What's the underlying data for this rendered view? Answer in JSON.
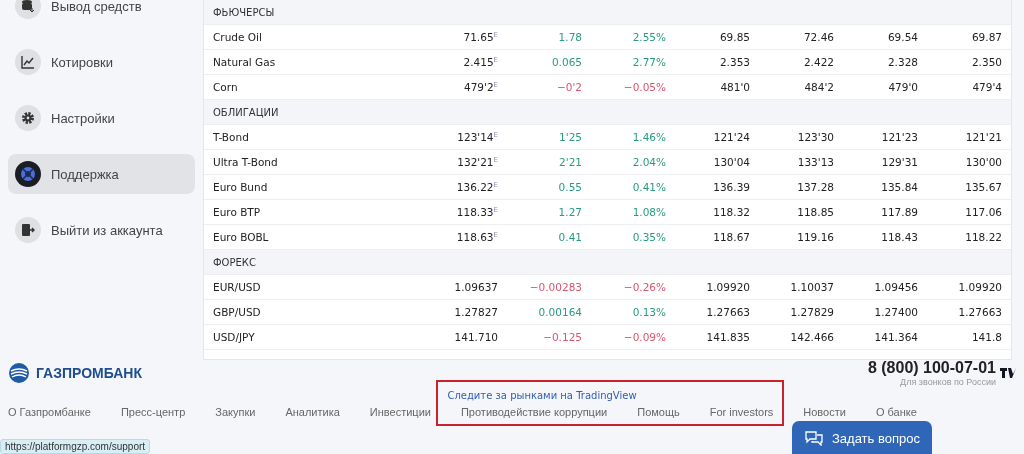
{
  "sidebar": {
    "items": [
      {
        "label": "Вывод средств",
        "kind": "withdraw",
        "selected": false
      },
      {
        "label": "Котировки",
        "kind": "chart",
        "selected": false
      },
      {
        "label": "Настройки",
        "kind": "gear",
        "selected": false
      },
      {
        "label": "Поддержка",
        "kind": "support",
        "selected": true
      },
      {
        "label": "Выйти из аккаунта",
        "kind": "logout",
        "selected": false
      }
    ]
  },
  "quotes": {
    "sections": [
      {
        "title": "ФЬЮЧЕРСЫ",
        "rows": [
          {
            "name": "Crude Oil",
            "last": "71.65$^{E}$",
            "change": "1.78",
            "change_pct": "2.55%",
            "negative": false,
            "open": "69.85",
            "high": "72.46",
            "low": "69.54",
            "prev": "69.87"
          },
          {
            "name": "Natural Gas",
            "last": "2.415$^{E}$",
            "change": "0.065",
            "change_pct": "2.77%",
            "negative": false,
            "open": "2.353",
            "high": "2.422",
            "low": "2.328",
            "prev": "2.350"
          },
          {
            "name": "Corn",
            "last": "479'2$^{E}$",
            "change": "−0'2",
            "change_pct": "−0.05%",
            "negative": true,
            "open": "481'0",
            "high": "484'2",
            "low": "479'0",
            "prev": "479'4"
          }
        ]
      },
      {
        "title": "ОБЛИГАЦИИ",
        "rows": [
          {
            "name": "T-Bond",
            "last": "123'14$^{E}$",
            "change": "1'25",
            "change_pct": "1.46%",
            "negative": false,
            "open": "121'24",
            "high": "123'30",
            "low": "121'23",
            "prev": "121'21"
          },
          {
            "name": "Ultra T-Bond",
            "last": "132'21$^{E}$",
            "change": "2'21",
            "change_pct": "2.04%",
            "negative": false,
            "open": "130'04",
            "high": "133'13",
            "low": "129'31",
            "prev": "130'00"
          },
          {
            "name": "Euro Bund",
            "last": "136.22$^{E}$",
            "change": "0.55",
            "change_pct": "0.41%",
            "negative": false,
            "open": "136.39",
            "high": "137.28",
            "low": "135.84",
            "prev": "135.67"
          },
          {
            "name": "Euro BTP",
            "last": "118.33$^{E}$",
            "change": "1.27",
            "change_pct": "1.08%",
            "negative": false,
            "open": "118.32",
            "high": "118.85",
            "low": "117.89",
            "prev": "117.06"
          },
          {
            "name": "Euro BOBL",
            "last": "118.63$^{E}$",
            "change": "0.41",
            "change_pct": "0.35%",
            "negative": false,
            "open": "118.67",
            "high": "119.16",
            "low": "118.43",
            "prev": "118.22"
          }
        ]
      },
      {
        "title": "ФОРЕКС",
        "rows": [
          {
            "name": "EUR/USD",
            "last": "1.09637",
            "change": "−0.00283",
            "change_pct": "−0.26%",
            "negative": true,
            "open": "1.09920",
            "high": "1.10037",
            "low": "1.09456",
            "prev": "1.09920"
          },
          {
            "name": "GBP/USD",
            "last": "1.27827",
            "change": "0.00164",
            "change_pct": "0.13%",
            "negative": false,
            "open": "1.27663",
            "high": "1.27829",
            "low": "1.27400",
            "prev": "1.27663"
          },
          {
            "name": "USD/JPY",
            "last": "141.710",
            "change": "−0.125",
            "change_pct": "−0.09%",
            "negative": true,
            "open": "141.835",
            "high": "142.466",
            "low": "141.364",
            "prev": "141.8"
          }
        ]
      }
    ],
    "link": "Следите за рынками на TradingView"
  },
  "footer": {
    "logo": "ГАЗПРОМБАНК",
    "phone": "8 (800) 100-07-01",
    "phone_note": "Для звонков по России",
    "links": [
      "О Газпромбанке",
      "Пресс-центр",
      "Закупки",
      "Аналитика",
      "Инвестиции",
      "Противодействие коррупции",
      "Помощь",
      "For investors",
      "Новости",
      "О банке"
    ],
    "ask_button": "Задать вопрос"
  },
  "status_url": "https://platformgzp.com/support"
}
